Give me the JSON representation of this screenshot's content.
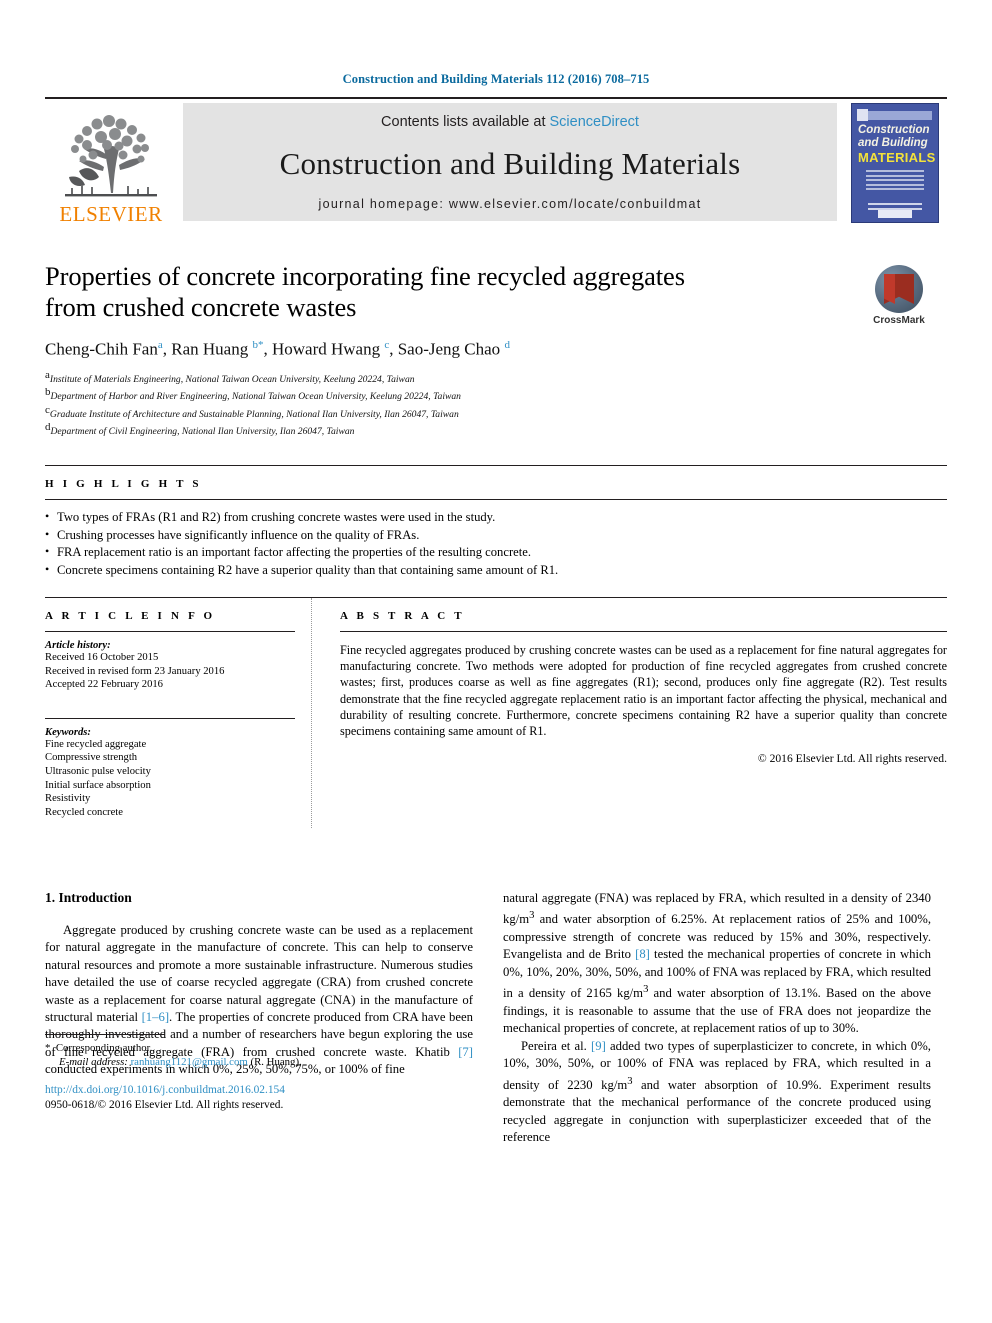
{
  "running_head": "Construction and Building Materials 112 (2016) 708–715",
  "masthead": {
    "publisher_logo_label": "ELSEVIER",
    "contents_prefix": "Contents lists available at ",
    "contents_link": "ScienceDirect",
    "journal_name": "Construction and Building Materials",
    "homepage": "journal homepage: www.elsevier.com/locate/conbuildmat",
    "cover": {
      "line1": "Construction",
      "line2": "and Building",
      "line3": "MATERIALS"
    }
  },
  "article": {
    "title": "Properties of concrete incorporating fine recycled aggregates from crushed concrete wastes",
    "crossmark_label": "CrossMark",
    "authors_html": "Cheng-Chih Fan<sup>a</sup>, Ran Huang <sup>b</sup><sup>*</sup>, Howard Hwang <sup>c</sup>, Sao-Jeng Chao <sup>d</sup>",
    "affiliations": [
      {
        "marker": "a",
        "text": "Institute of Materials Engineering, National Taiwan Ocean University, Keelung 20224, Taiwan"
      },
      {
        "marker": "b",
        "text": "Department of Harbor and River Engineering, National Taiwan Ocean University, Keelung 20224, Taiwan"
      },
      {
        "marker": "c",
        "text": "Graduate Institute of Architecture and Sustainable Planning, National Ilan University, Ilan 26047, Taiwan"
      },
      {
        "marker": "d",
        "text": "Department of Civil Engineering, National Ilan University, Ilan 26047, Taiwan"
      }
    ]
  },
  "highlights": {
    "heading": "H I G H L I G H T S",
    "items": [
      "Two types of FRAs (R1 and R2) from crushing concrete wastes were used in the study.",
      "Crushing processes have significantly influence on the quality of FRAs.",
      "FRA replacement ratio is an important factor affecting the properties of the resulting concrete.",
      "Concrete specimens containing R2 have a superior quality than that containing same amount of R1."
    ]
  },
  "article_info": {
    "heading": "A R T I C L E    I N F O",
    "history_label": "Article history:",
    "history": [
      "Received 16 October 2015",
      "Received in revised form 23 January 2016",
      "Accepted 22 February 2016"
    ],
    "keywords_label": "Keywords:",
    "keywords": [
      "Fine recycled aggregate",
      "Compressive strength",
      "Ultrasonic pulse velocity",
      "Initial surface absorption",
      "Resistivity",
      "Recycled concrete"
    ]
  },
  "abstract": {
    "heading": "A B S T R A C T",
    "text": "Fine recycled aggregates produced by crushing concrete wastes can be used as a replacement for fine natural aggregates for manufacturing concrete. Two methods were adopted for production of fine recycled aggregates from crushed concrete wastes; first, produces coarse as well as fine aggregates (R1); second, produces only fine aggregate (R2). Test results demonstrate that the fine recycled aggregate replacement ratio is an important factor affecting the physical, mechanical and durability of resulting concrete. Furthermore, concrete specimens containing R2 have a superior quality than concrete specimens containing same amount of R1.",
    "copyright": "© 2016 Elsevier Ltd. All rights reserved."
  },
  "body": {
    "section_number_title": "1. Introduction",
    "left_paragraph_1_html": "Aggregate produced by crushing concrete waste can be used as a replacement for natural aggregate in the manufacture of concrete. This can help to conserve natural resources and promote a more sustainable infrastructure. Numerous studies have detailed the use of coarse recycled aggregate (CRA) from crushed concrete waste as a replacement for coarse natural aggregate (CNA) in the manufacture of structural material <span class=\"ref\">[1–6]</span>. The properties of concrete produced from CRA have been thoroughly investigated and a number of researchers have begun exploring the use of fine recycled aggregate (FRA) from crushed concrete waste. Khatib <span class=\"ref\">[7]</span> conducted experiments in which 0%, 25%, 50%, 75%, or 100% of fine",
    "right_paragraph_1_html": "natural aggregate (FNA) was replaced by FRA, which resulted in a density of 2340 kg/m<sup>3</sup> and water absorption of 6.25%. At replacement ratios of 25% and 100%, compressive strength of concrete was reduced by 15% and 30%, respectively. Evangelista and de Brito <span class=\"ref\">[8]</span> tested the mechanical properties of concrete in which 0%, 10%, 20%, 30%, 50%, and 100% of FNA was replaced by FRA, which resulted in a density of 2165 kg/m<sup>3</sup> and water absorption of 13.1%. Based on the above findings, it is reasonable to assume that the use of FRA does not jeopardize the mechanical properties of concrete, at replacement ratios of up to 30%.",
    "right_paragraph_2_html": "Pereira et al. <span class=\"ref\">[9]</span> added two types of superplasticizer to concrete, in which 0%, 10%, 30%, 50%, or 100% of FNA was replaced by FRA, which resulted in a density of 2230 kg/m<sup>3</sup> and water absorption of 10.9%. Experiment results demonstrate that the mechanical performance of the concrete produced using recycled aggregate in conjunction with superplasticizer exceeded that of the reference"
  },
  "footnote": {
    "corresponding_marker": "*",
    "corresponding_text": "Corresponding author.",
    "email_label": "E-mail address:",
    "email": "ranhuang1121@gmail.com",
    "email_suffix": "(R. Huang).",
    "doi": "http://dx.doi.org/10.1016/j.conbuildmat.2016.02.154",
    "issn_line": "0950-0618/© 2016 Elsevier Ltd. All rights reserved."
  },
  "colors": {
    "link": "#2f8fc4",
    "running_head": "#0b6a9e",
    "elsevier_orange": "#f08000",
    "masthead_grey": "#e3e3e3"
  }
}
